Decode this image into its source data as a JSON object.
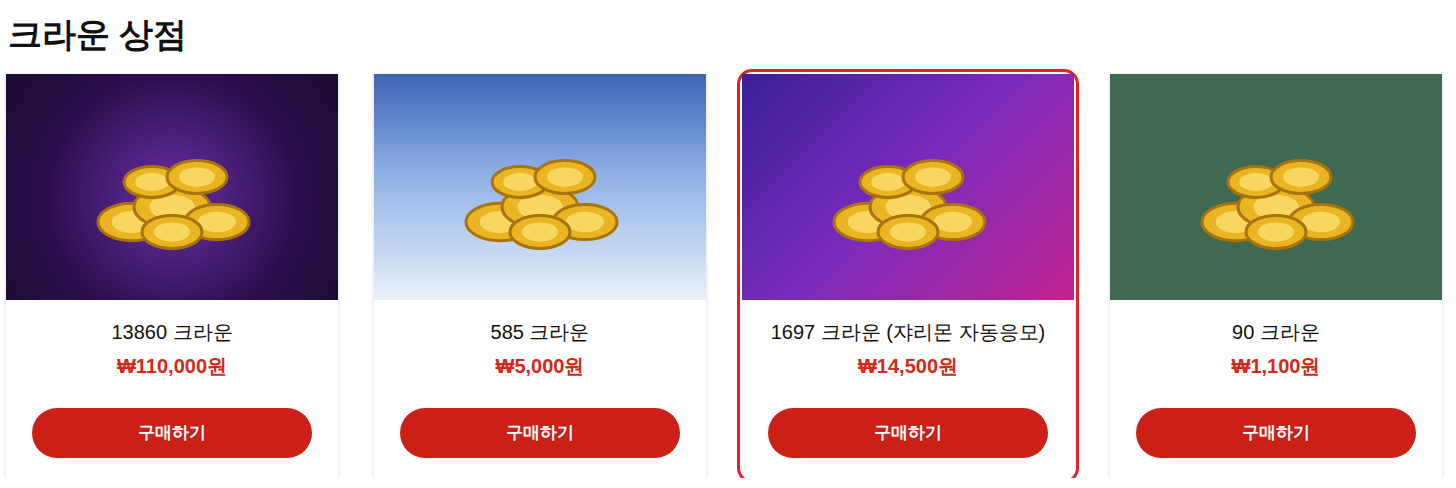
{
  "title": "크라운 상점",
  "products": [
    {
      "name": "13860 크라운",
      "price": "₩110,000원",
      "button": "구매하기",
      "selected": false
    },
    {
      "name": "585 크라운",
      "price": "₩5,000원",
      "button": "구매하기",
      "selected": false
    },
    {
      "name": "1697 크라운 (쟈리몬 자동응모)",
      "price": "₩14,500원",
      "button": "구매하기",
      "selected": true
    },
    {
      "name": "90 크라운",
      "price": "₩1,100원",
      "button": "구매하기",
      "selected": false
    }
  ]
}
